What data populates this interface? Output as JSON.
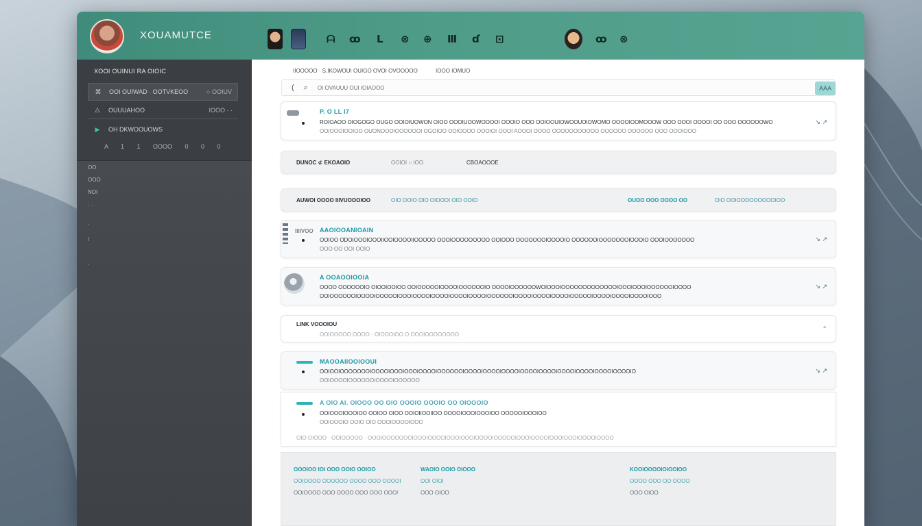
{
  "window": {
    "app_title": "XOUAMUTCE",
    "header_icons": [
      "person-icon",
      "photo-icon",
      "chart-icon",
      "table-icon",
      "graph-icon",
      "compass-icon",
      "grid-icon",
      "layers-icon",
      "link-icon",
      "document-icon"
    ],
    "header_right_icons": [
      "user-icon",
      "chart-icon",
      "grid-icon"
    ]
  },
  "sidebar": {
    "heading": "XOOI OUINUI RA OIOIC",
    "rows": [
      {
        "icon": "⌘",
        "label": "OOI OUIWAD · OOTVKEOO",
        "value": "○ OOIUV",
        "highlight": true
      },
      {
        "icon": "△",
        "label": "OUUUAHOO",
        "value": "IOOO · ·",
        "highlight": false
      },
      {
        "icon": "▶",
        "label": "OH    DKWOOUOWS",
        "value": "",
        "highlight": false
      }
    ],
    "mini_row": "A 1 1 OOOO 0 0 0",
    "items": [
      "OO",
      "OOO",
      "NOI",
      "· ·",
      "·",
      "/",
      "·"
    ]
  },
  "main": {
    "breadcrumb_left": "IIOOOOO · S,IKOWOUI OUIGO OVOI OVOOOOO",
    "breadcrumb_right": "IOOO IOMUO",
    "search": {
      "placeholder": "OI OVAUUU OUI IOIAOOO",
      "button": "AAA"
    },
    "card1": {
      "title": "P. O LL I7",
      "line1": "ROIOAOO OIOGOGO OUGO OOIOIUOWON OIOO OOOIUOOWOOOOI OOOIO OOO OOIOOUIOWOOUOIOWOMO OOOOIOOMOOOW OOO OOOI OOOOI OO OOO OOOOOOWOO",
      "line2": "OOIOOOIOOIOO OUONOOOIOOOOOOI OGOIOO OOIOOOO OOOIOI OOOI AOOOI OOOO OOOOOOOOOOO OOOOOO OOOOOO OOO OOOIOOO"
    },
    "filter_bar": {
      "label": "DUNOC ⊄ EKOAOIO",
      "mid": "OOIOI  ○ IOO",
      "right": "CBOAOOOE"
    },
    "table_header": {
      "col1": "AUWOI OOOO IIIVUOOOIOO",
      "col2": "OIO OOIO OIO OIOOOI OIO OOIO",
      "col3": "OUOO OOO OOOO OO",
      "col4": "OIO OOIOOOOOOOOOIOO"
    },
    "card2": {
      "tag": "IIIIVOO",
      "title": "AAOIOOANIOAIN",
      "line1": "OOIOO ODOIOOOIOOOIIOOIOOOOIIOOOOO OOOIOOOOOOOOO OOIOOO OOOOOOOIOOOOIO OOOOOOIOOOOOOOIOOOIO OOOIOOOOOOO",
      "line2": "OOO OO OOI OOIO"
    },
    "card3": {
      "title": "A OOAOOIOOIA",
      "line1": "OOOO OOOOOOIO OIOOIOOIOO OOIOOOOOIOOOOIOOOOOOIO OOOOIOOOOOOWOIOOOIOOOOOOOOOOOOOIOOOIOOOIOOOOOOIOOOO",
      "line2": "OOIOOOOOOIOOOOIOOOOOIOOOIOOOOIOOOOIOOOOIOOOOIOOOOOOIOOOOIOOOOIOOOOIOOOOOIOOOOIOOOOIOOOOIOOO"
    },
    "card4": {
      "title": "LINK VOOOIOU",
      "line1": "OOIOOOOO OOOO · OIOOOIOO O OOOIOOOOOOOO"
    },
    "card5": {
      "title": "MAOOAIIOOIOOUI",
      "line1": "OOIOOIOOOOOOOIOOOOIOOOIOOOIOOOOIOOOOOOIOOOOIOOOOIOOOOIOOOOIOOOOIOOOOIOOOOIOOOOIOOOOIO",
      "line2": "OOIOOOOIOOOOOOIOOOOIOOOOOO"
    },
    "card6": {
      "title": "A OIO AI. OIOOO OO OIO OOOIO OOOIO OO OIOOOIO",
      "line1": "OOIOOOIOOOIOO OOIOO OIOO OOIOIIOOIIOO OOOOIOOOIOOOIOO OOOOOIOOOIOO",
      "line2": "OOIOOOIO OOIO OIO OOOIOOOOIOOO",
      "footer": "OIO OIOOO · OOIOOOOO · OOOIOOOOOOOIOOOIOOOOIOOOIOOOIOOOOIOOOOOIOOOIOOOOIOOOIOOOIOOOOIOOOO"
    },
    "footer_panel": {
      "col1": [
        "OOOIOO IOI OOO OOIO OOIOO",
        "OOIOOOO OOOOOO OOOO OOO OOOOI",
        "OOIOOOO OOO OOOO OOO OOO OOO/"
      ],
      "col2": [
        "WAOIO OOIO OIOOO",
        "OOI OIOI",
        "OOO OIOO"
      ],
      "col3": [
        "KOOIOOOOIOIOOIOO",
        "OOOO OOO OO OOOO",
        "OOO OIOO"
      ]
    }
  }
}
